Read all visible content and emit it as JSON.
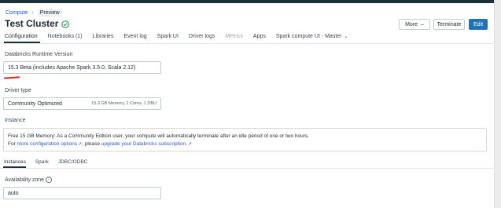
{
  "breadcrumb": {
    "parent": "Compute",
    "separator": "›",
    "current": "Preview"
  },
  "title": "Test Cluster",
  "status": {
    "icon": "check-circle-icon",
    "color": "#3aa05f"
  },
  "actions": {
    "more_label": "More",
    "more_icon": "ellipsis-icon",
    "terminate_label": "Terminate",
    "edit_label": "Edit"
  },
  "tabs": [
    {
      "label": "Configuration",
      "active": true
    },
    {
      "label": "Notebooks (1)"
    },
    {
      "label": "Libraries"
    },
    {
      "label": "Event log"
    },
    {
      "label": "Spark UI"
    },
    {
      "label": "Driver logs"
    },
    {
      "label": "Metrics",
      "disabled": true
    },
    {
      "label": "Apps"
    },
    {
      "label": "Spark compute UI - Master",
      "has_dropdown": true
    }
  ],
  "runtime": {
    "label": "Databricks Runtime Version",
    "value": "15.3 Beta (includes Apache Spark 3.5.0, Scala 2.12)"
  },
  "driver": {
    "label": "Driver type",
    "value": "Community Optimized",
    "spec": "15.3 GB Memory, 2 Cores, 1 DBU"
  },
  "instance": {
    "label": "Instance",
    "line1": "Free 15 GB Memory: As a Community Edition user, your compute will automatically terminate after an idle period of one or two hours.",
    "line2_prefix": "For",
    "line2_link1": "more configuration options",
    "line2_mid": ", please",
    "line2_link2": "upgrade your Databricks subscription."
  },
  "subtabs": [
    {
      "label": "Instances",
      "active": true
    },
    {
      "label": "Spark"
    },
    {
      "label": "JDBC/ODBC"
    }
  ],
  "availability": {
    "label": "Availability zone",
    "value": "auto"
  },
  "colors": {
    "accent": "#2272b4",
    "annotation_red": "#d71f26",
    "link": "#2a5bd7"
  }
}
